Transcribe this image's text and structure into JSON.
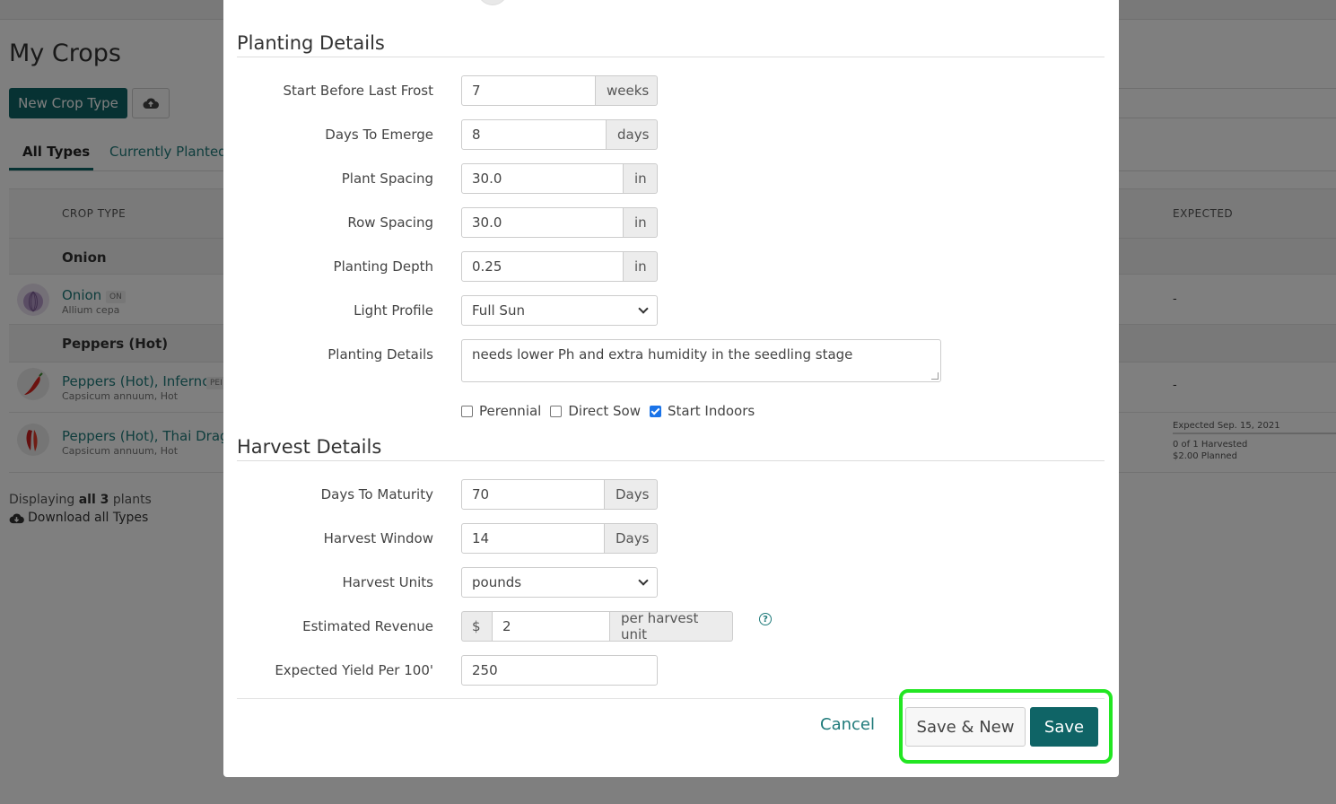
{
  "page": {
    "title": "My Crops",
    "new_crop_label": "New Crop Type",
    "upload_icon": "cloud-upload-icon",
    "tabs": [
      "All Types",
      "Currently Planted"
    ],
    "table": {
      "col_crop_type": "CROP TYPE",
      "col_expected": "EXPECTED",
      "groups": [
        {
          "label": "Onion"
        },
        {
          "label": "Peppers (Hot)"
        }
      ],
      "rows": [
        {
          "name": "Onion",
          "tag": "ON",
          "scientific": "Allium cepa",
          "expected": "-"
        },
        {
          "name": "Peppers (Hot), Inferno",
          "tag": "PEI",
          "scientific": "Capsicum annuum, Hot",
          "expected": "-"
        },
        {
          "name": "Peppers (Hot), Thai Drago",
          "tag": "",
          "scientific": "Capsicum annuum, Hot",
          "expected_date": "Expected Sep. 15, 2021",
          "harvested": "0 of 1 Harvested",
          "planned": "$2.00 Planned"
        }
      ]
    },
    "footer": {
      "displaying_prefix": "Displaying",
      "displaying_bold": "all 3",
      "displaying_suffix": "plants",
      "download_label": "Download all Types"
    }
  },
  "modal": {
    "planting_title": "Planting Details",
    "harvest_title": "Harvest Details",
    "fields": {
      "start_before_frost": {
        "label": "Start Before Last Frost",
        "value": "7",
        "unit": "weeks"
      },
      "days_to_emerge": {
        "label": "Days To Emerge",
        "value": "8",
        "unit": "days"
      },
      "plant_spacing": {
        "label": "Plant Spacing",
        "value": "30.0",
        "unit": "in"
      },
      "row_spacing": {
        "label": "Row Spacing",
        "value": "30.0",
        "unit": "in"
      },
      "planting_depth": {
        "label": "Planting Depth",
        "value": "0.25",
        "unit": "in"
      },
      "light_profile": {
        "label": "Light Profile",
        "value": "Full Sun"
      },
      "planting_details": {
        "label": "Planting Details",
        "value": "needs lower Ph and extra humidity in the seedling stage"
      },
      "days_to_maturity": {
        "label": "Days To Maturity",
        "value": "70",
        "unit": "Days"
      },
      "harvest_window": {
        "label": "Harvest Window",
        "value": "14",
        "unit": "Days"
      },
      "harvest_units": {
        "label": "Harvest Units",
        "value": "pounds"
      },
      "estimated_revenue": {
        "label": "Estimated Revenue",
        "prefix": "$",
        "value": "2",
        "unit": "per harvest unit"
      },
      "expected_yield": {
        "label": "Expected Yield Per 100'",
        "value": "250"
      }
    },
    "checkboxes": [
      {
        "label": "Perennial",
        "checked": false
      },
      {
        "label": "Direct Sow",
        "checked": false
      },
      {
        "label": "Start Indoors",
        "checked": true
      }
    ],
    "help_icon": "help-circle-icon",
    "buttons": {
      "cancel": "Cancel",
      "save_new": "Save & New",
      "save": "Save"
    }
  },
  "colors": {
    "primary": "#0f6466",
    "link": "#1f7a7a",
    "highlight": "#22e622",
    "overlay": "rgba(0,0,0,0.5)"
  }
}
